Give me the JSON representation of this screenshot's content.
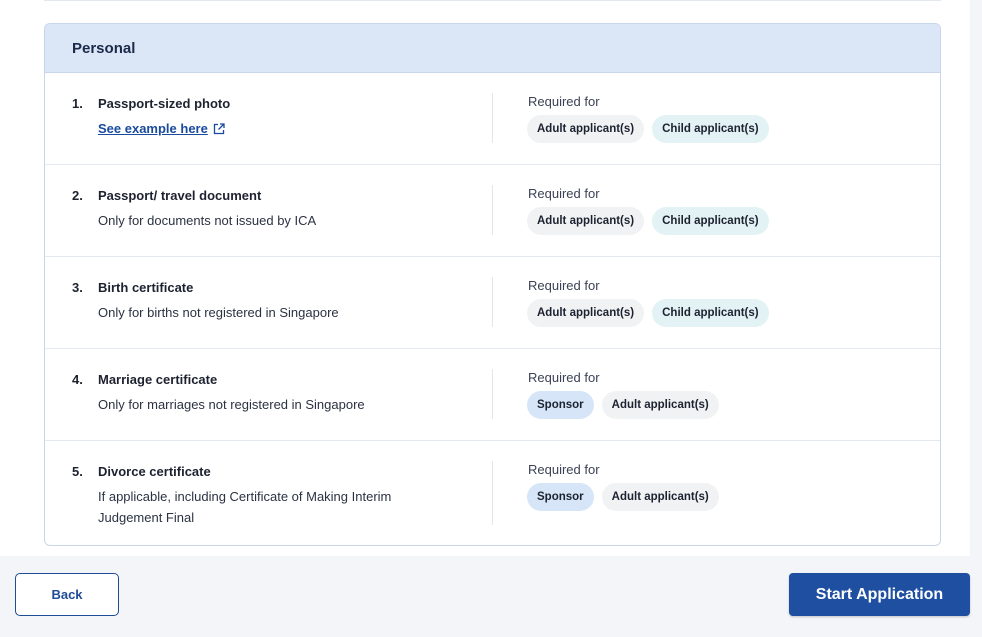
{
  "section": {
    "title": "Personal",
    "required_for_label": "Required for",
    "items": [
      {
        "number": "1.",
        "title": "Passport-sized photo",
        "link_text": "See example here",
        "tags": [
          "Adult applicant(s)",
          "Child applicant(s)"
        ]
      },
      {
        "number": "2.",
        "title": "Passport/ travel document",
        "subtitle": "Only for documents not issued by ICA",
        "tags": [
          "Adult applicant(s)",
          "Child applicant(s)"
        ]
      },
      {
        "number": "3.",
        "title": "Birth certificate",
        "subtitle": "Only for births not registered in Singapore",
        "tags": [
          "Adult applicant(s)",
          "Child applicant(s)"
        ]
      },
      {
        "number": "4.",
        "title": "Marriage certificate",
        "subtitle": "Only for marriages not registered in Singapore",
        "tags": [
          "Sponsor",
          "Adult applicant(s)"
        ]
      },
      {
        "number": "5.",
        "title": "Divorce certificate",
        "subtitle": "If applicable, including Certificate of Making Interim Judgement Final",
        "tags": [
          "Sponsor",
          "Adult applicant(s)"
        ]
      }
    ]
  },
  "footer": {
    "back_label": "Back",
    "start_label": "Start Application"
  },
  "icons": {
    "external_link": "external-link-icon"
  },
  "colors": {
    "primary": "#1e4fa0",
    "header_bg": "#dbe6f6",
    "tag_gray": "#f1f2f4",
    "tag_teal": "#e3f2f4",
    "tag_blue": "#d6e6f8"
  }
}
